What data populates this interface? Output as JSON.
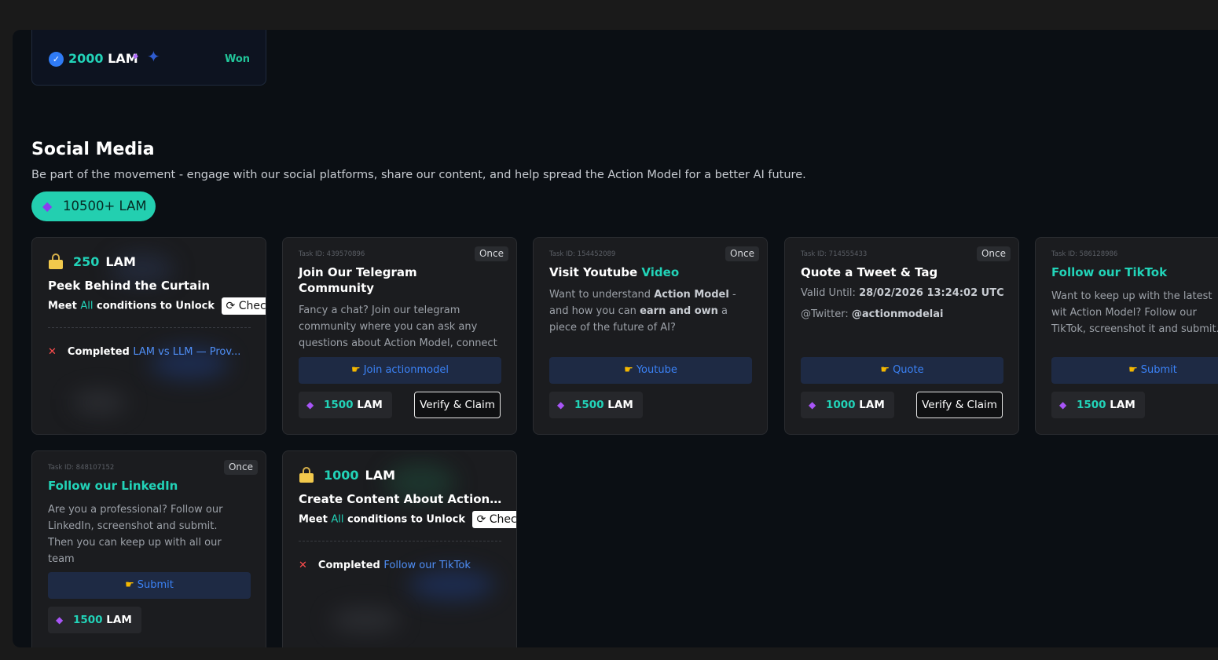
{
  "won_card": {
    "amount": "2000",
    "unit": "LAM",
    "status": "Won"
  },
  "section": {
    "title": "Social Media",
    "description": "Be part of the movement - engage with our social platforms, share our content, and help spread the Action Model for a better AI future.",
    "total_reward": "10500+ LAM"
  },
  "locked_cards": [
    {
      "amount": "250",
      "unit": "LAM",
      "title": "Peek Behind the Curtain",
      "meet": "Meet",
      "all": "All",
      "conditions": "conditions to Unlock",
      "check": "Check",
      "completed": "Completed",
      "requirement": "LAM vs LLM — Prov..."
    },
    {
      "amount": "1000",
      "unit": "LAM",
      "title": "Create Content About Action Mod...",
      "meet": "Meet",
      "all": "All",
      "conditions": "conditions to Unlock",
      "check": "Check",
      "completed": "Completed",
      "requirement": "Follow our TikTok"
    }
  ],
  "tasks": [
    {
      "task_id": "Task ID: 439570896",
      "frequency": "Once",
      "title": "Join Our Telegram Community",
      "description": "Fancy a chat? Join our telegram community where you can ask any questions about Action Model, connect",
      "action": "Join actionmodel",
      "reward": "1500",
      "reward_unit": "LAM",
      "verify": "Verify & Claim"
    },
    {
      "task_id": "Task ID: 154452089",
      "frequency": "Once",
      "title_prefix": "Visit Youtube",
      "title_accent": "Video",
      "desc_1": "Want to understand",
      "desc_bold_1": "Action Model",
      "desc_2": "- and how you can",
      "desc_bold_2": "earn and own",
      "desc_3": "a piece of the future of AI?",
      "action": "Youtube",
      "reward": "1500",
      "reward_unit": "LAM"
    },
    {
      "task_id": "Task ID: 714555433",
      "frequency": "Once",
      "title": "Quote a Tweet & Tag",
      "valid_label": "Valid Until:",
      "valid_value": "28/02/2026 13:24:02 UTC",
      "twitter_label": "@Twitter:",
      "twitter_value": "@actionmodelai",
      "action": "Quote",
      "reward": "1000",
      "reward_unit": "LAM",
      "verify": "Verify & Claim"
    },
    {
      "task_id": "Task ID: 586128986",
      "title": "Follow our TikTok",
      "description": "Want to keep up with the latest wit Action Model? Follow our TikTok, screenshot it and submit.",
      "action": "Submit",
      "reward": "1500",
      "reward_unit": "LAM"
    },
    {
      "task_id": "Task ID: 848107152",
      "frequency": "Once",
      "title": "Follow our LinkedIn",
      "description": "Are you a professional? Follow our LinkedIn, screenshot and submit. Then you can keep up with all our team",
      "action": "Submit",
      "reward": "1500",
      "reward_unit": "LAM"
    }
  ],
  "colors": {
    "accent": "#22d3b8",
    "link": "#3b82f6",
    "background": "#0b0f14",
    "card": "#1b1c1f"
  }
}
